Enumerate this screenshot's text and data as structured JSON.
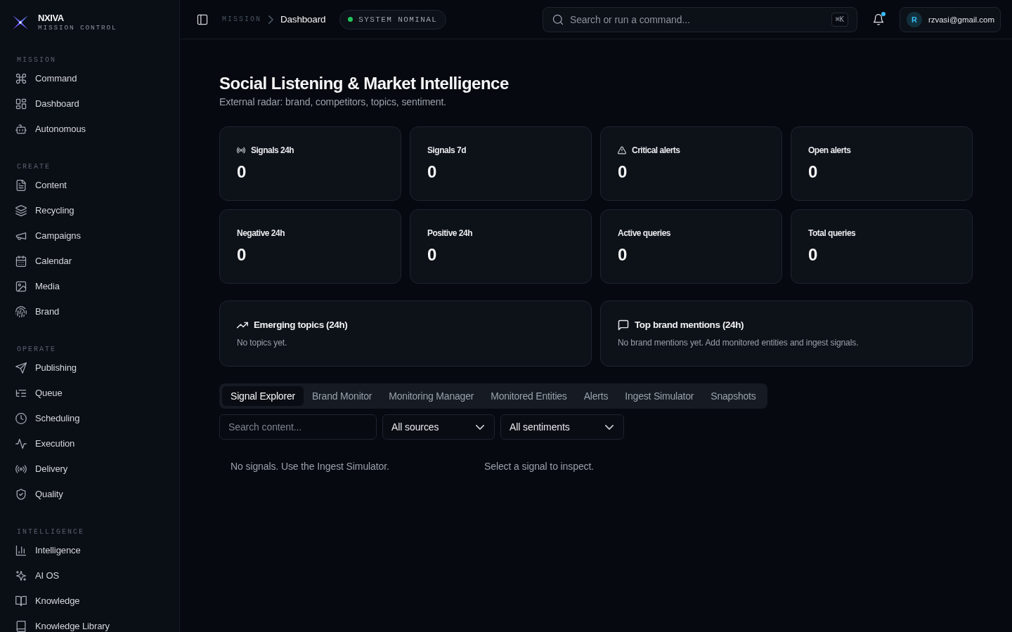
{
  "sidebar": {
    "brand": {
      "name": "NXIVA",
      "tagline": "MISSION CONTROL"
    },
    "sections": [
      {
        "title": "MISSION",
        "items": [
          {
            "label": "Command",
            "selected": false
          },
          {
            "label": "Dashboard",
            "selected": false
          },
          {
            "label": "Autonomous",
            "selected": false
          }
        ]
      },
      {
        "title": "CREATE",
        "items": [
          {
            "label": "Content",
            "selected": false
          },
          {
            "label": "Recycling",
            "selected": false
          },
          {
            "label": "Campaigns",
            "selected": false
          },
          {
            "label": "Calendar",
            "selected": false
          },
          {
            "label": "Media",
            "selected": false
          },
          {
            "label": "Brand",
            "selected": false
          }
        ]
      },
      {
        "title": "OPERATE",
        "items": [
          {
            "label": "Publishing",
            "selected": false
          },
          {
            "label": "Queue",
            "selected": false
          },
          {
            "label": "Scheduling",
            "selected": false
          },
          {
            "label": "Execution",
            "selected": false
          },
          {
            "label": "Delivery",
            "selected": false
          },
          {
            "label": "Quality",
            "selected": false
          }
        ]
      },
      {
        "title": "INTELLIGENCE",
        "items": [
          {
            "label": "Intelligence",
            "selected": false
          },
          {
            "label": "AI OS",
            "selected": false
          },
          {
            "label": "Knowledge",
            "selected": false
          },
          {
            "label": "Knowledge Library",
            "selected": false
          }
        ]
      }
    ]
  },
  "topbar": {
    "breadcrumb": [
      "MISSION",
      "Dashboard"
    ],
    "status": {
      "label": "SYSTEM NOMINAL",
      "healthy": true
    },
    "search": {
      "placeholder": "Search or run a command...",
      "shortcut": "⌘K"
    },
    "notifications": {
      "unread": true
    },
    "user": {
      "initial": "R",
      "email": "rzvasi@gmail.com"
    }
  },
  "page": {
    "title": "Social Listening & Market Intelligence",
    "subtitle": "External radar: brand, competitors, topics, sentiment."
  },
  "stats": [
    {
      "label": "Signals 24h",
      "value": "0"
    },
    {
      "label": "Signals 7d",
      "value": "0"
    },
    {
      "label": "Critical alerts",
      "value": "0"
    },
    {
      "label": "Open alerts",
      "value": "0"
    },
    {
      "label": "Negative 24h",
      "value": "0"
    },
    {
      "label": "Positive 24h",
      "value": "0"
    },
    {
      "label": "Active queries",
      "value": "0"
    },
    {
      "label": "Total queries",
      "value": "0"
    }
  ],
  "panels": [
    {
      "title": "Emerging topics (24h)",
      "message": "No topics yet."
    },
    {
      "title": "Top brand mentions (24h)",
      "message": "No brand mentions yet. Add monitored entities and ingest signals."
    }
  ],
  "explorer": {
    "tabs": [
      {
        "label": "Signal Explorer",
        "selected": true
      },
      {
        "label": "Brand Monitor",
        "selected": false
      },
      {
        "label": "Monitoring Manager",
        "selected": false
      },
      {
        "label": "Monitored Entities",
        "selected": false
      },
      {
        "label": "Alerts",
        "selected": false
      },
      {
        "label": "Ingest Simulator",
        "selected": false
      },
      {
        "label": "Snapshots",
        "selected": false
      }
    ],
    "filters": {
      "search": {
        "placeholder": "Search content..."
      },
      "selects": [
        {
          "value": "All sources"
        },
        {
          "value": "All sentiments"
        }
      ]
    },
    "results": {
      "list_message": "No signals. Use the Ingest Simulator.",
      "detail_message": "Select a signal to inspect."
    }
  }
}
